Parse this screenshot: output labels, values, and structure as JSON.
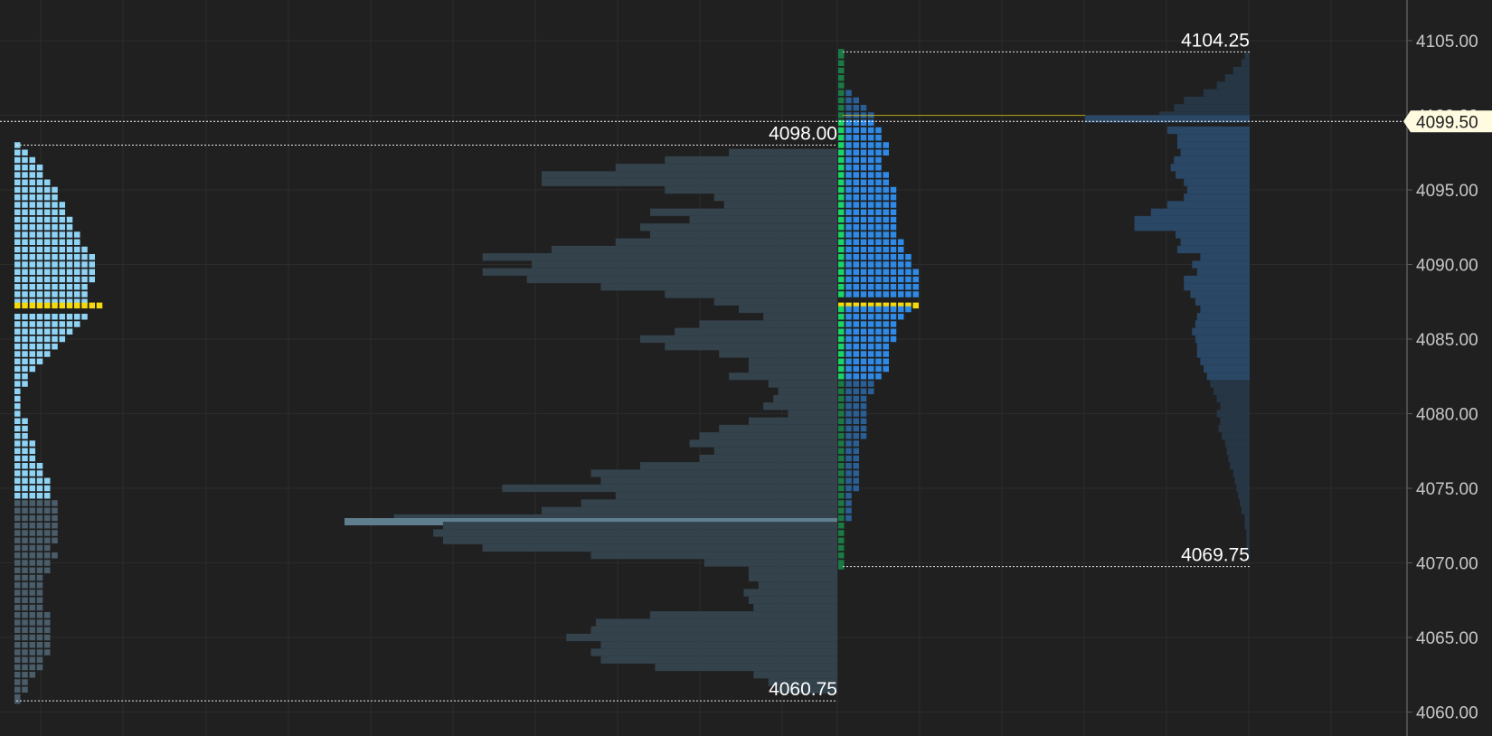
{
  "colors": {
    "background": "#202020",
    "grid": "#2c2c2c",
    "axis_line": "#5a5a5a",
    "axis_text": "#c8c8c8",
    "poc": "#f5d90a",
    "day1_tpo_value_area": "#8fd3f5",
    "day1_tpo_outside": "#4a5d6b",
    "day1_volume": "#33424b",
    "day1_volume_poc": "#5f7f8f",
    "day2_tpo_blue": "#2e8ae6",
    "day2_tpo_dark": "#2a5f95",
    "day2_tpo_initiative": "#19d468",
    "day2_tpo_initiative_dark": "#1a7a45",
    "day2_volume": "#263644",
    "day2_volume_value_area": "#2a4766",
    "last_price_tag_bg": "#fffbe0",
    "range_line": "#e8e8e8"
  },
  "chart_data": {
    "type": "market_profile",
    "tick_size": 0.25,
    "y_axis": {
      "ylim": [
        4058.25,
        4107.75
      ],
      "ticks": [
        "4105.00",
        "4100.00",
        "4095.00",
        "4090.00",
        "4085.00",
        "4080.00",
        "4075.00",
        "4070.00",
        "4065.00",
        "4060.00"
      ]
    },
    "last_price": "4099.50",
    "sessions": [
      {
        "high": "4098.00",
        "low": "4060.75",
        "poc": 4087.25,
        "value_area": [
          4074.5,
          4098.0
        ],
        "tpo_profile": [
          [
            4098.0,
            1
          ],
          [
            4097.5,
            2
          ],
          [
            4097.0,
            3
          ],
          [
            4096.5,
            4
          ],
          [
            4096.0,
            4
          ],
          [
            4095.5,
            5
          ],
          [
            4095.0,
            6
          ],
          [
            4094.5,
            6
          ],
          [
            4094.0,
            7
          ],
          [
            4093.5,
            7
          ],
          [
            4093.0,
            8
          ],
          [
            4092.5,
            8
          ],
          [
            4092.0,
            9
          ],
          [
            4091.5,
            9
          ],
          [
            4091.0,
            10
          ],
          [
            4090.5,
            11
          ],
          [
            4090.0,
            11
          ],
          [
            4089.5,
            11
          ],
          [
            4089.0,
            11
          ],
          [
            4088.5,
            10
          ],
          [
            4088.0,
            10
          ],
          [
            4087.5,
            10
          ],
          [
            4087.25,
            12
          ],
          [
            4086.5,
            10
          ],
          [
            4086.0,
            9
          ],
          [
            4085.5,
            8
          ],
          [
            4085.0,
            7
          ],
          [
            4084.5,
            6
          ],
          [
            4084.0,
            5
          ],
          [
            4083.5,
            4
          ],
          [
            4083.0,
            3
          ],
          [
            4082.5,
            2
          ],
          [
            4082.0,
            2
          ],
          [
            4081.5,
            1
          ],
          [
            4081.0,
            1
          ],
          [
            4080.5,
            1
          ],
          [
            4080.0,
            1
          ],
          [
            4079.5,
            2
          ],
          [
            4079.0,
            2
          ],
          [
            4078.5,
            2
          ],
          [
            4078.0,
            3
          ],
          [
            4077.5,
            3
          ],
          [
            4077.0,
            3
          ],
          [
            4076.5,
            4
          ],
          [
            4076.0,
            4
          ],
          [
            4075.5,
            5
          ],
          [
            4075.0,
            5
          ],
          [
            4074.5,
            5
          ],
          [
            4074.0,
            6
          ],
          [
            4073.5,
            6
          ],
          [
            4073.0,
            6
          ],
          [
            4072.5,
            6
          ],
          [
            4072.0,
            6
          ],
          [
            4071.5,
            6
          ],
          [
            4071.0,
            5
          ],
          [
            4070.5,
            6
          ],
          [
            4070.0,
            5
          ],
          [
            4069.5,
            5
          ],
          [
            4069.0,
            4
          ],
          [
            4068.5,
            4
          ],
          [
            4068.0,
            4
          ],
          [
            4067.5,
            4
          ],
          [
            4067.0,
            4
          ],
          [
            4066.5,
            5
          ],
          [
            4066.0,
            5
          ],
          [
            4065.5,
            5
          ],
          [
            4065.0,
            5
          ],
          [
            4064.5,
            5
          ],
          [
            4064.0,
            5
          ],
          [
            4063.5,
            4
          ],
          [
            4063.0,
            4
          ],
          [
            4062.5,
            3
          ],
          [
            4062.0,
            2
          ],
          [
            4061.5,
            2
          ],
          [
            4061.0,
            1
          ],
          [
            4060.75,
            1
          ]
        ],
        "volume_profile": [
          [
            4097.5,
            22
          ],
          [
            4097.0,
            35
          ],
          [
            4096.5,
            45
          ],
          [
            4096.0,
            60
          ],
          [
            4095.5,
            60
          ],
          [
            4095.0,
            35
          ],
          [
            4094.5,
            25
          ],
          [
            4094.0,
            23
          ],
          [
            4093.5,
            38
          ],
          [
            4093.0,
            30
          ],
          [
            4092.5,
            40
          ],
          [
            4092.0,
            38
          ],
          [
            4091.5,
            45
          ],
          [
            4091.0,
            58
          ],
          [
            4090.5,
            72
          ],
          [
            4090.0,
            62
          ],
          [
            4089.5,
            72
          ],
          [
            4089.0,
            63
          ],
          [
            4088.5,
            48
          ],
          [
            4088.0,
            35
          ],
          [
            4087.5,
            25
          ],
          [
            4087.0,
            20
          ],
          [
            4086.5,
            15
          ],
          [
            4086.0,
            28
          ],
          [
            4085.5,
            33
          ],
          [
            4085.0,
            40
          ],
          [
            4084.5,
            35
          ],
          [
            4084.0,
            24
          ],
          [
            4083.5,
            18
          ],
          [
            4083.0,
            18
          ],
          [
            4082.5,
            22
          ],
          [
            4082.0,
            14
          ],
          [
            4081.5,
            12
          ],
          [
            4081.0,
            13
          ],
          [
            4080.5,
            15
          ],
          [
            4080.0,
            10
          ],
          [
            4079.5,
            18
          ],
          [
            4079.0,
            24
          ],
          [
            4078.5,
            28
          ],
          [
            4078.0,
            30
          ],
          [
            4077.5,
            25
          ],
          [
            4077.0,
            28
          ],
          [
            4076.5,
            40
          ],
          [
            4076.0,
            50
          ],
          [
            4075.5,
            48
          ],
          [
            4075.0,
            68
          ],
          [
            4074.5,
            45
          ],
          [
            4074.0,
            52
          ],
          [
            4073.5,
            60
          ],
          [
            4073.0,
            90
          ],
          [
            4072.75,
            100
          ],
          [
            4072.5,
            80
          ],
          [
            4072.0,
            82
          ],
          [
            4071.5,
            80
          ],
          [
            4071.0,
            72
          ],
          [
            4070.5,
            50
          ],
          [
            4070.0,
            27
          ],
          [
            4069.5,
            18
          ],
          [
            4069.0,
            18
          ],
          [
            4068.5,
            16
          ],
          [
            4068.0,
            19
          ],
          [
            4067.5,
            18
          ],
          [
            4067.0,
            17
          ],
          [
            4066.5,
            38
          ],
          [
            4066.0,
            49
          ],
          [
            4065.5,
            50
          ],
          [
            4065.0,
            55
          ],
          [
            4064.5,
            48
          ],
          [
            4064.0,
            50
          ],
          [
            4063.5,
            48
          ],
          [
            4063.0,
            37
          ],
          [
            4062.5,
            17
          ],
          [
            4062.0,
            14
          ],
          [
            4061.5,
            12
          ]
        ]
      },
      {
        "high": "4104.25",
        "low": "4069.75",
        "poc": 4087.25,
        "value_area": [
          4082.5,
          4099.5
        ],
        "tpo_profile": [
          [
            4104.25,
            1
          ],
          [
            4104.0,
            1
          ],
          [
            4103.5,
            1
          ],
          [
            4103.0,
            1
          ],
          [
            4102.5,
            1
          ],
          [
            4102.0,
            1
          ],
          [
            4101.5,
            2
          ],
          [
            4101.0,
            3
          ],
          [
            4100.5,
            4
          ],
          [
            4100.0,
            5
          ],
          [
            4099.5,
            5
          ],
          [
            4099.0,
            6
          ],
          [
            4098.5,
            6
          ],
          [
            4098.0,
            7
          ],
          [
            4097.5,
            7
          ],
          [
            4097.0,
            6
          ],
          [
            4096.5,
            6
          ],
          [
            4096.0,
            7
          ],
          [
            4095.5,
            7
          ],
          [
            4095.0,
            8
          ],
          [
            4094.5,
            8
          ],
          [
            4094.0,
            8
          ],
          [
            4093.5,
            8
          ],
          [
            4093.0,
            8
          ],
          [
            4092.5,
            8
          ],
          [
            4092.0,
            8
          ],
          [
            4091.5,
            9
          ],
          [
            4091.0,
            9
          ],
          [
            4090.5,
            10
          ],
          [
            4090.0,
            10
          ],
          [
            4089.5,
            11
          ],
          [
            4089.0,
            11
          ],
          [
            4088.5,
            11
          ],
          [
            4088.0,
            11
          ],
          [
            4087.25,
            11
          ],
          [
            4087.0,
            10
          ],
          [
            4086.5,
            9
          ],
          [
            4086.0,
            8
          ],
          [
            4085.5,
            8
          ],
          [
            4085.0,
            8
          ],
          [
            4084.5,
            7
          ],
          [
            4084.0,
            7
          ],
          [
            4083.5,
            7
          ],
          [
            4083.0,
            7
          ],
          [
            4082.5,
            6
          ],
          [
            4082.0,
            5
          ],
          [
            4081.5,
            5
          ],
          [
            4081.0,
            4
          ],
          [
            4080.5,
            4
          ],
          [
            4080.0,
            4
          ],
          [
            4079.5,
            4
          ],
          [
            4079.0,
            4
          ],
          [
            4078.5,
            4
          ],
          [
            4078.0,
            3
          ],
          [
            4077.5,
            3
          ],
          [
            4077.0,
            3
          ],
          [
            4076.5,
            3
          ],
          [
            4076.0,
            3
          ],
          [
            4075.5,
            3
          ],
          [
            4075.0,
            3
          ],
          [
            4074.5,
            2
          ],
          [
            4074.0,
            2
          ],
          [
            4073.5,
            2
          ],
          [
            4073.0,
            2
          ],
          [
            4072.5,
            1
          ],
          [
            4072.0,
            1
          ],
          [
            4071.5,
            1
          ],
          [
            4071.0,
            1
          ],
          [
            4070.5,
            1
          ],
          [
            4070.0,
            1
          ],
          [
            4069.75,
            1
          ]
        ],
        "volume_profile": [
          [
            4104.0,
            3
          ],
          [
            4103.5,
            5
          ],
          [
            4103.0,
            10
          ],
          [
            4102.5,
            15
          ],
          [
            4102.0,
            20
          ],
          [
            4101.5,
            28
          ],
          [
            4101.0,
            40
          ],
          [
            4100.5,
            46
          ],
          [
            4100.0,
            55
          ],
          [
            4099.75,
            100
          ],
          [
            4099.0,
            50
          ],
          [
            4098.5,
            44
          ],
          [
            4098.0,
            44
          ],
          [
            4097.5,
            42
          ],
          [
            4097.0,
            46
          ],
          [
            4096.5,
            48
          ],
          [
            4096.0,
            45
          ],
          [
            4095.5,
            40
          ],
          [
            4095.0,
            38
          ],
          [
            4094.5,
            40
          ],
          [
            4094.0,
            50
          ],
          [
            4093.5,
            60
          ],
          [
            4093.0,
            70
          ],
          [
            4092.5,
            70
          ],
          [
            4092.0,
            45
          ],
          [
            4091.5,
            42
          ],
          [
            4091.0,
            44
          ],
          [
            4090.5,
            30
          ],
          [
            4090.0,
            35
          ],
          [
            4089.5,
            32
          ],
          [
            4089.0,
            40
          ],
          [
            4088.5,
            40
          ],
          [
            4088.0,
            36
          ],
          [
            4087.5,
            33
          ],
          [
            4087.0,
            30
          ],
          [
            4086.5,
            32
          ],
          [
            4086.0,
            33
          ],
          [
            4085.5,
            35
          ],
          [
            4085.0,
            33
          ],
          [
            4084.5,
            32
          ],
          [
            4084.0,
            32
          ],
          [
            4083.5,
            30
          ],
          [
            4083.0,
            28
          ],
          [
            4082.5,
            26
          ],
          [
            4082.0,
            24
          ],
          [
            4081.5,
            22
          ],
          [
            4081.0,
            20
          ],
          [
            4080.5,
            18
          ],
          [
            4080.0,
            20
          ],
          [
            4079.5,
            18
          ],
          [
            4079.0,
            19
          ],
          [
            4078.5,
            17
          ],
          [
            4078.0,
            15
          ],
          [
            4077.5,
            14
          ],
          [
            4077.0,
            13
          ],
          [
            4076.5,
            12
          ],
          [
            4076.0,
            10
          ],
          [
            4075.5,
            9
          ],
          [
            4075.0,
            8
          ],
          [
            4074.5,
            7
          ],
          [
            4074.0,
            6
          ],
          [
            4073.5,
            5
          ],
          [
            4073.0,
            3
          ],
          [
            4072.5,
            3
          ],
          [
            4072.0,
            2
          ],
          [
            4071.5,
            2
          ],
          [
            4071.0,
            2
          ],
          [
            4070.5,
            1
          ]
        ]
      }
    ]
  }
}
